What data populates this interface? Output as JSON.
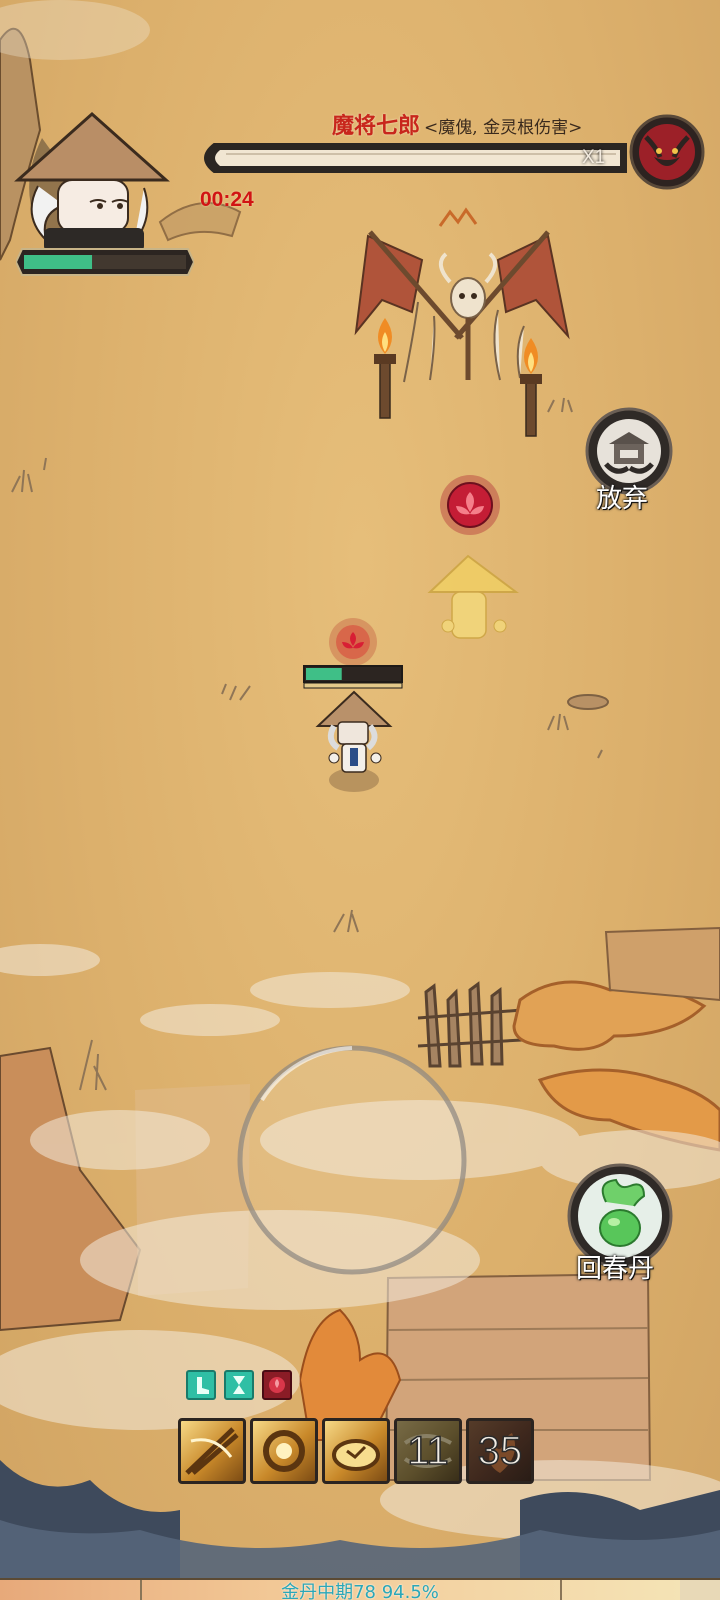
{
  "boss": {
    "name": "魔将七郎",
    "tag": "<魔傀, 金灵根伤害>",
    "multiplier": "X1",
    "hp_fraction": 1.0
  },
  "timer": "00:24",
  "player": {
    "hp_fraction": 0.42,
    "field_hp_fraction": 0.38
  },
  "actions": {
    "abandon_label": "放弃",
    "pill_label": "回春丹"
  },
  "skills": {
    "slots": [
      {
        "name": "sword-slash-skill",
        "cooldown": ""
      },
      {
        "name": "golden-vortex-skill",
        "cooldown": ""
      },
      {
        "name": "golden-shield-skill",
        "cooldown": ""
      },
      {
        "name": "wind-skill",
        "cooldown": "11"
      },
      {
        "name": "flame-skill",
        "cooldown": "35"
      }
    ]
  },
  "buffs": [
    "boot-speed-icon",
    "hourglass-icon",
    "demon-lotus-icon"
  ],
  "experience": {
    "label": "金丹中期78 94.5%",
    "fraction": 0.945
  },
  "colors": {
    "boss_name": "#c8261c",
    "timer": "#d11414",
    "hp_green": "#3fbf87",
    "exp_text": "#2aa7b8"
  }
}
